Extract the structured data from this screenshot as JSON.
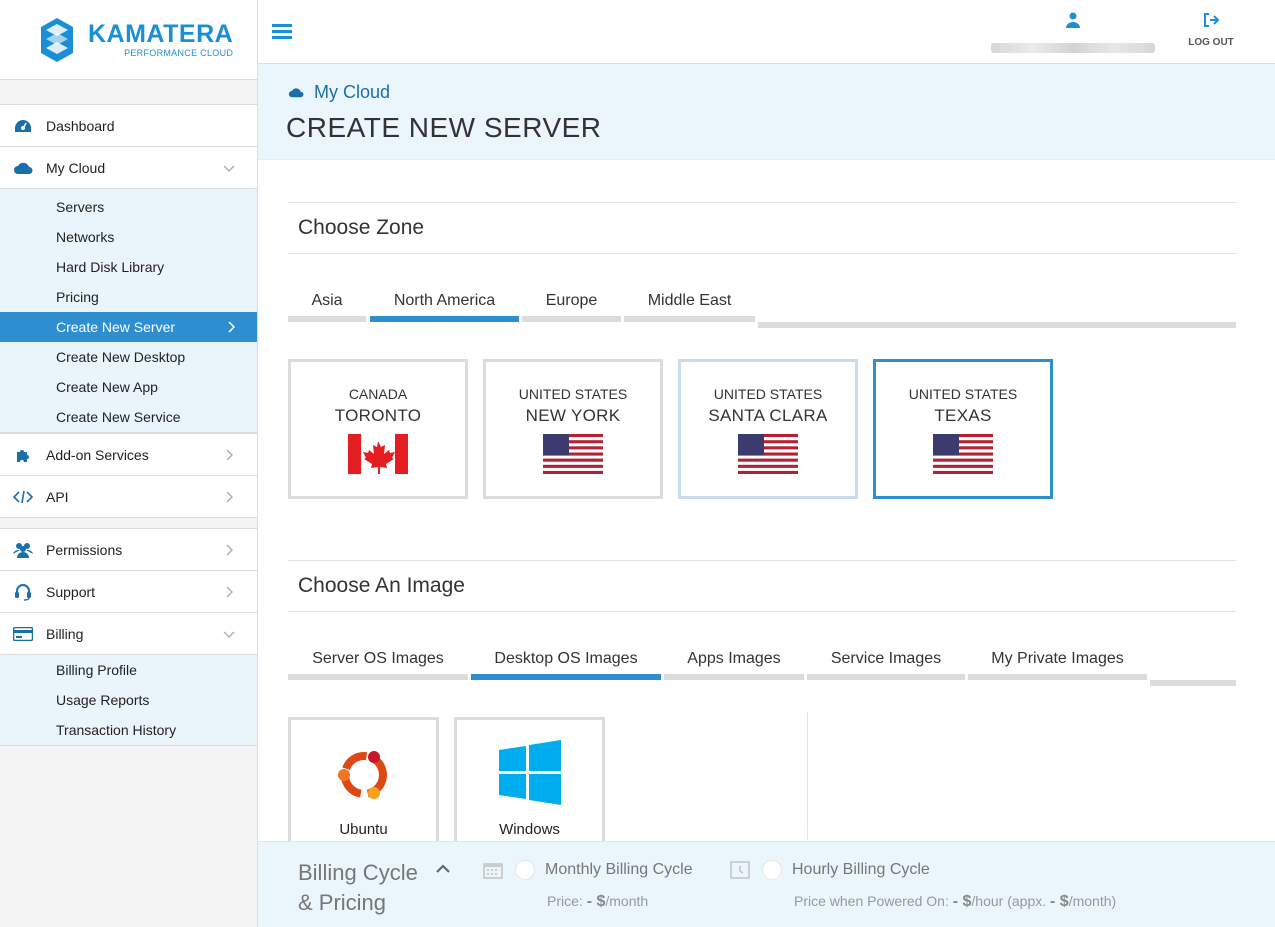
{
  "brand": {
    "name": "KAMATERA",
    "tagline": "PERFORMANCE CLOUD",
    "color": "#1b8fd6"
  },
  "topbar": {
    "user_icon": "user-icon",
    "logout_label": "LOG OUT",
    "logout_icon": "logout-icon"
  },
  "sidebar": {
    "group1": [
      {
        "label": "Dashboard",
        "icon": "dashboard-icon"
      },
      {
        "label": "My Cloud",
        "icon": "cloud-icon",
        "expanded": true
      }
    ],
    "mycloud_sub": [
      {
        "label": "Servers"
      },
      {
        "label": "Networks"
      },
      {
        "label": "Hard Disk Library"
      },
      {
        "label": "Pricing"
      },
      {
        "label": "Create New Server",
        "active": true
      },
      {
        "label": "Create New Desktop"
      },
      {
        "label": "Create New App"
      },
      {
        "label": "Create New Service"
      }
    ],
    "group2": [
      {
        "label": "Add-on Services",
        "icon": "puzzle-icon"
      },
      {
        "label": "API",
        "icon": "code-icon"
      }
    ],
    "group3": [
      {
        "label": "Permissions",
        "icon": "users-icon"
      },
      {
        "label": "Support",
        "icon": "headset-icon"
      },
      {
        "label": "Billing",
        "icon": "credit-card-icon",
        "expanded": true
      }
    ],
    "billing_sub": [
      {
        "label": "Billing Profile"
      },
      {
        "label": "Usage Reports"
      },
      {
        "label": "Transaction History"
      }
    ],
    "active_color": "#2d8fd0"
  },
  "header": {
    "breadcrumb": "My Cloud",
    "title": "CREATE NEW SERVER"
  },
  "zone": {
    "title": "Choose Zone",
    "tabs": [
      "Asia",
      "North America",
      "Europe",
      "Middle East"
    ],
    "active_tab": "North America",
    "cards": [
      {
        "country": "CANADA",
        "city": "TORONTO",
        "flag": "canada-flag-icon"
      },
      {
        "country": "UNITED STATES",
        "city": "NEW YORK",
        "flag": "usa-flag-icon"
      },
      {
        "country": "UNITED STATES",
        "city": "SANTA CLARA",
        "flag": "usa-flag-icon"
      },
      {
        "country": "UNITED STATES",
        "city": "TEXAS",
        "flag": "usa-flag-icon",
        "selected": true
      }
    ]
  },
  "image": {
    "title": "Choose An Image",
    "tabs": [
      "Server OS Images",
      "Desktop OS Images",
      "Apps Images",
      "Service Images",
      "My Private Images"
    ],
    "active_tab": "Desktop OS Images",
    "cards": [
      {
        "name": "Ubuntu",
        "icon": "ubuntu-logo-icon"
      },
      {
        "name": "Windows",
        "icon": "windows-logo-icon"
      }
    ]
  },
  "billing": {
    "title_line1": "Billing Cycle",
    "title_line2": "& Pricing",
    "monthly": {
      "label": "Monthly Billing Cycle",
      "price_prefix": "Price: ",
      "price_value": "- $",
      "price_suffix": "/month"
    },
    "hourly": {
      "label": "Hourly Billing Cycle",
      "price_prefix": "Price when Powered On: ",
      "price_value": "- $",
      "price_mid": "/hour (appx. ",
      "price_value2": "- $",
      "price_suffix": "/month)"
    }
  }
}
